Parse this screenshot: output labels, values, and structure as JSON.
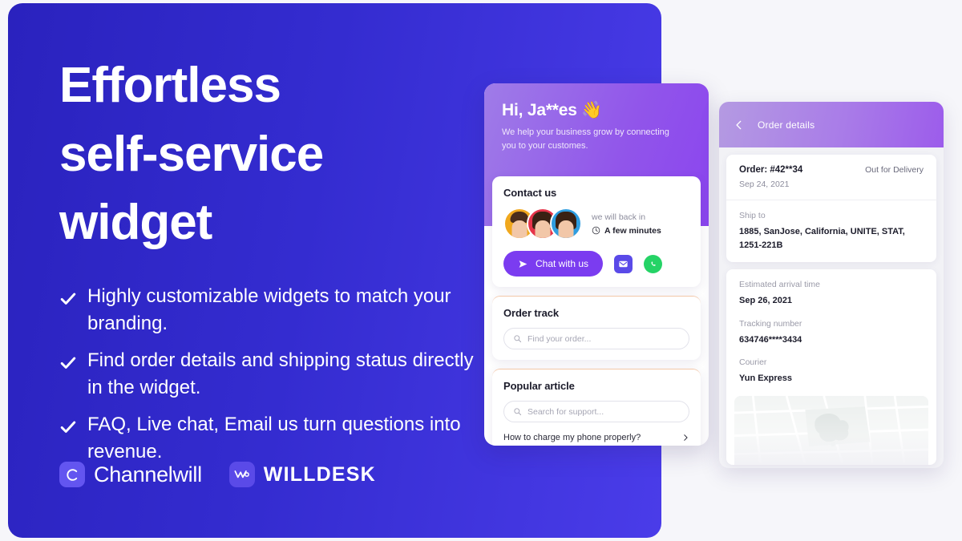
{
  "hero": {
    "title": "Effortless\nself-service\nwidget",
    "bullets": [
      "Highly customizable widgets to match your branding.",
      "Find order details and shipping status directly in the widget.",
      "FAQ, Live chat, Email us turn questions into revenue."
    ],
    "brands": [
      {
        "badge": "C",
        "name": "Channelwill"
      },
      {
        "badge": "w",
        "name": "WILLDESK"
      }
    ],
    "colors": {
      "gradient_start": "#2a22be",
      "gradient_end": "#4a3ce9"
    }
  },
  "widget": {
    "greeting": "Hi, Ja**es 👋",
    "subtitle": "We help your business grow by connecting you to your customes.",
    "contact": {
      "title": "Contact us",
      "eta_label": "we will back in",
      "eta_value": "A few minutes",
      "chat_button": "Chat with us",
      "email_icon": "email-icon",
      "whatsapp_icon": "whatsapp-icon"
    },
    "order_track": {
      "title": "Order track",
      "search_placeholder": "Find your order..."
    },
    "popular_article": {
      "title": "Popular article",
      "search_placeholder": "Search for support...",
      "articles": [
        "How to charge my phone properly?"
      ]
    },
    "colors": {
      "header_start": "#9f7ce8",
      "header_end": "#8b45ef",
      "button": "#7b3cf0",
      "whatsapp": "#25d366"
    }
  },
  "order_details": {
    "header_title": "Order details",
    "back_icon": "chevron-left-icon",
    "order_number": "Order: #42**34",
    "status": "Out for Delivery",
    "order_date": "Sep 24, 2021",
    "fields": [
      {
        "label": "Ship to",
        "value": "1885, SanJose, California, UNITE, STAT, 1251-221B"
      }
    ],
    "shipment": [
      {
        "label": "Estimated arrival time",
        "value": "Sep 26, 2021"
      },
      {
        "label": "Tracking number",
        "value": "634746****3434"
      },
      {
        "label": "Courier",
        "value": "Yun Express"
      }
    ],
    "colors": {
      "header_start": "#b49ae2",
      "header_end": "#9c5ceb"
    }
  }
}
